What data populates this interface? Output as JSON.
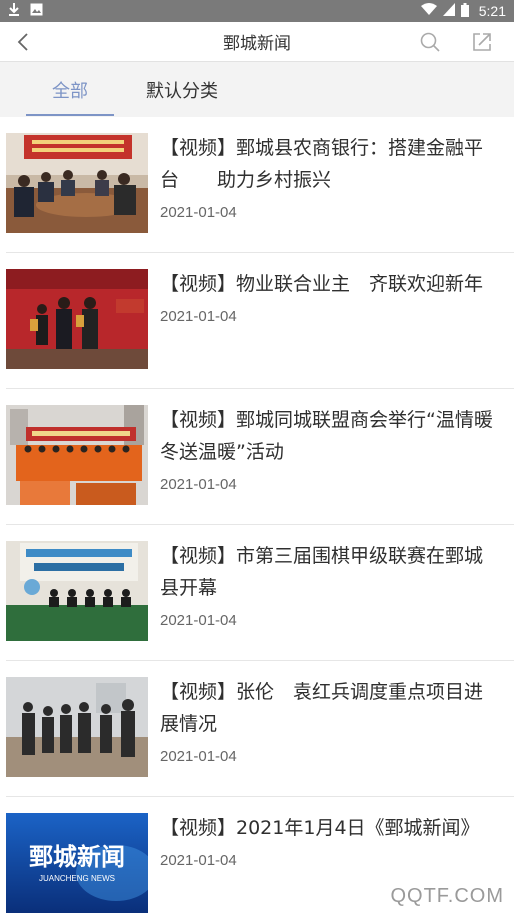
{
  "status_bar": {
    "time": "5:21"
  },
  "header": {
    "title": "鄄城新闻"
  },
  "tabs": [
    {
      "label": "全部",
      "active": true
    },
    {
      "label": "默认分类",
      "active": false
    }
  ],
  "news": [
    {
      "title": "【视频】鄄城县农商银行：搭建金融平台　　助力乡村振兴",
      "date": "2021-01-04"
    },
    {
      "title": "【视频】物业联合业主　齐联欢迎新年",
      "date": "2021-01-04"
    },
    {
      "title": "【视频】鄄城同城联盟商会举行“温情暖冬送温暖”活动",
      "date": "2021-01-04"
    },
    {
      "title": "【视频】市第三届围棋甲级联赛在鄄城县开幕",
      "date": "2021-01-04"
    },
    {
      "title": "【视频】张伦　袁红兵调度重点项目进展情况",
      "date": "2021-01-04"
    },
    {
      "title": "【视频】2021年1月4日《鄄城新闻》",
      "date": "2021-01-04"
    }
  ],
  "thumb6_logo": {
    "main": "鄄城新闻",
    "sub": "JUANCHENG NEWS"
  },
  "watermark": "QQTF.COM",
  "colors": {
    "accent": "#7d94c6",
    "status_bar": "#7a7a7a",
    "tab_bg": "#f3f3f3"
  }
}
